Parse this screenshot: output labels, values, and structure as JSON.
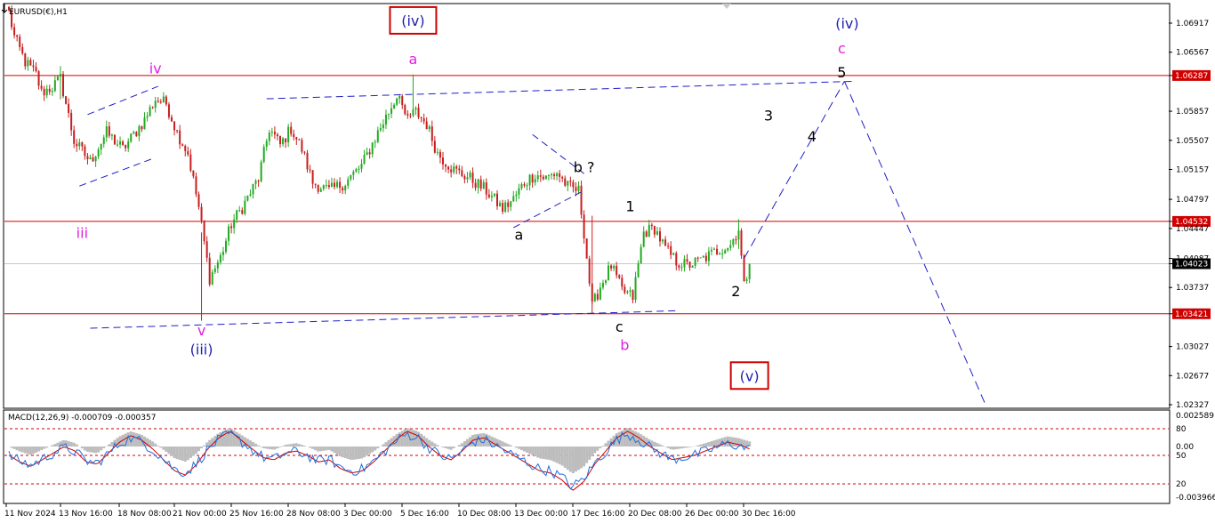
{
  "chart_data": {
    "type": "candlestick-wave-analysis",
    "symbol_label": "EURUSD(€),H1",
    "indicator_label": "MACD(12,26,9) -0.000709 -0.000357",
    "price_axis_ticks": [
      "1.06917",
      "1.06567",
      "1.06287",
      "1.05857",
      "1.05507",
      "1.05157",
      "1.04797",
      "1.04532",
      "1.04447",
      "1.04087",
      "1.04023",
      "1.03737",
      "1.03421",
      "1.03027",
      "1.02677",
      "1.02327"
    ],
    "price_range": [
      1.02327,
      1.07187
    ],
    "horizontal_levels": [
      {
        "value": 1.06287,
        "label": "1.06287",
        "color": "#d00000"
      },
      {
        "value": 1.04532,
        "label": "1.04532",
        "color": "#d00000"
      },
      {
        "value": 1.04023,
        "label": "1.04023",
        "color": "#000000"
      },
      {
        "value": 1.03421,
        "label": "1.03421",
        "color": "#d00000"
      }
    ],
    "time_axis_ticks": [
      "11 Nov 2024",
      "13 Nov 16:00",
      "18 Nov 08:00",
      "21 Nov 00:00",
      "25 Nov 16:00",
      "28 Nov 08:00",
      "3 Dec 00:00",
      "5 Dec 16:00",
      "10 Dec 08:00",
      "13 Dec 00:00",
      "17 Dec 16:00",
      "20 Dec 08:00",
      "26 Dec 00:00",
      "30 Dec 16:00"
    ],
    "price_path": [
      {
        "i": 0,
        "p": 1.0705
      },
      {
        "i": 2,
        "p": 1.0675
      },
      {
        "i": 6,
        "p": 1.0645
      },
      {
        "i": 10,
        "p": 1.063
      },
      {
        "i": 12,
        "p": 1.0608
      },
      {
        "i": 16,
        "p": 1.0615
      },
      {
        "i": 19,
        "p": 1.0625
      },
      {
        "i": 24,
        "p": 1.055
      },
      {
        "i": 30,
        "p": 1.0525
      },
      {
        "i": 36,
        "p": 1.056
      },
      {
        "i": 42,
        "p": 1.054
      },
      {
        "i": 50,
        "p": 1.0575
      },
      {
        "i": 54,
        "p": 1.06
      },
      {
        "i": 58,
        "p": 1.0595
      },
      {
        "i": 62,
        "p": 1.056
      },
      {
        "i": 66,
        "p": 1.0535
      },
      {
        "i": 70,
        "p": 1.047
      },
      {
        "i": 74,
        "p": 1.0385
      },
      {
        "i": 78,
        "p": 1.041
      },
      {
        "i": 82,
        "p": 1.045
      },
      {
        "i": 86,
        "p": 1.047
      },
      {
        "i": 92,
        "p": 1.0505
      },
      {
        "i": 96,
        "p": 1.0565
      },
      {
        "i": 100,
        "p": 1.0545
      },
      {
        "i": 104,
        "p": 1.0565
      },
      {
        "i": 108,
        "p": 1.054
      },
      {
        "i": 112,
        "p": 1.05
      },
      {
        "i": 118,
        "p": 1.049
      },
      {
        "i": 124,
        "p": 1.05
      },
      {
        "i": 130,
        "p": 1.052
      },
      {
        "i": 136,
        "p": 1.056
      },
      {
        "i": 140,
        "p": 1.0585
      },
      {
        "i": 144,
        "p": 1.061
      },
      {
        "i": 146,
        "p": 1.0575
      },
      {
        "i": 150,
        "p": 1.0585
      },
      {
        "i": 154,
        "p": 1.057
      },
      {
        "i": 158,
        "p": 1.0535
      },
      {
        "i": 164,
        "p": 1.0515
      },
      {
        "i": 170,
        "p": 1.0505
      },
      {
        "i": 176,
        "p": 1.049
      },
      {
        "i": 182,
        "p": 1.0468
      },
      {
        "i": 186,
        "p": 1.048
      },
      {
        "i": 190,
        "p": 1.05
      },
      {
        "i": 194,
        "p": 1.051
      },
      {
        "i": 198,
        "p": 1.0505
      },
      {
        "i": 202,
        "p": 1.0512
      },
      {
        "i": 206,
        "p": 1.0495
      },
      {
        "i": 210,
        "p": 1.049
      },
      {
        "i": 212,
        "p": 1.044
      },
      {
        "i": 215,
        "p": 1.035
      },
      {
        "i": 218,
        "p": 1.0375
      },
      {
        "i": 222,
        "p": 1.04
      },
      {
        "i": 226,
        "p": 1.037
      },
      {
        "i": 230,
        "p": 1.0362
      },
      {
        "i": 234,
        "p": 1.044
      },
      {
        "i": 238,
        "p": 1.0445
      },
      {
        "i": 242,
        "p": 1.042
      },
      {
        "i": 246,
        "p": 1.0405
      },
      {
        "i": 250,
        "p": 1.04
      },
      {
        "i": 254,
        "p": 1.0405
      },
      {
        "i": 258,
        "p": 1.0412
      },
      {
        "i": 262,
        "p": 1.042
      },
      {
        "i": 266,
        "p": 1.0425
      },
      {
        "i": 269,
        "p": 1.0445
      },
      {
        "i": 271,
        "p": 1.0375
      },
      {
        "i": 273,
        "p": 1.0402
      }
    ],
    "wave_labels": [
      {
        "text": "(iv)",
        "price": 1.0695,
        "bar": 149,
        "color": "#1f1fb0",
        "boxed": true
      },
      {
        "text": "a",
        "price": 1.06487,
        "bar": 149,
        "color": "#e020e0"
      },
      {
        "text": "iv",
        "price": 1.06377,
        "bar": 54,
        "color": "#e020e0"
      },
      {
        "text": "iii",
        "price": 1.04397,
        "bar": 27,
        "color": "#e020e0"
      },
      {
        "text": "v",
        "price": 1.03227,
        "bar": 71,
        "color": "#e020e0"
      },
      {
        "text": "(iii)",
        "price": 1.02997,
        "bar": 71,
        "color": "#1f1fb0"
      },
      {
        "text": "b ?",
        "price": 1.05187,
        "bar": 212,
        "color": "#000000"
      },
      {
        "text": "a",
        "price": 1.04377,
        "bar": 188,
        "color": "#000000"
      },
      {
        "text": "1",
        "price": 1.04717,
        "bar": 229,
        "color": "#000000"
      },
      {
        "text": "c",
        "price": 1.03267,
        "bar": 225,
        "color": "#000000"
      },
      {
        "text": "b",
        "price": 1.03047,
        "bar": 227,
        "color": "#e020e0"
      },
      {
        "text": "2",
        "price": 1.03697,
        "bar": 268,
        "color": "#000000"
      },
      {
        "text": "3",
        "price": 1.05807,
        "bar": 280,
        "color": "#000000"
      },
      {
        "text": "4",
        "price": 1.05557,
        "bar": 296,
        "color": "#000000"
      },
      {
        "text": "(iv)",
        "price": 1.06917,
        "bar": 309,
        "color": "#1f1fb0"
      },
      {
        "text": "c",
        "price": 1.06617,
        "bar": 307,
        "color": "#e020e0"
      },
      {
        "text": "5",
        "price": 1.06327,
        "bar": 307,
        "color": "#000000"
      },
      {
        "text": "(v)",
        "price": 1.02677,
        "bar": 273,
        "color": "#1f1fb0",
        "boxed": true
      }
    ],
    "projection_path": [
      {
        "bar": 271,
        "price": 1.04087
      },
      {
        "bar": 308,
        "price": 1.06217
      },
      {
        "bar": 360,
        "price": 1.02327
      }
    ],
    "trendlines": [
      {
        "from": {
          "bar": 95,
          "price": 1.06007
        },
        "to": {
          "bar": 311,
          "price": 1.06217
        }
      },
      {
        "from": {
          "bar": 30,
          "price": 1.03247
        },
        "to": {
          "bar": 246,
          "price": 1.03457
        }
      },
      {
        "from": {
          "bar": 29,
          "price": 1.05817
        },
        "to": {
          "bar": 55,
          "price": 1.06157
        }
      },
      {
        "from": {
          "bar": 26,
          "price": 1.04957
        },
        "to": {
          "bar": 53,
          "price": 1.05287
        }
      },
      {
        "from": {
          "bar": 193,
          "price": 1.05577
        },
        "to": {
          "bar": 212,
          "price": 1.05107
        }
      },
      {
        "from": {
          "bar": 186,
          "price": 1.04457
        },
        "to": {
          "bar": 211,
          "price": 1.04887
        }
      }
    ],
    "macd": {
      "levels": [
        "80",
        "50",
        "20"
      ],
      "value_ticks": [
        "0.002589",
        "0.00",
        "-0.003966"
      ],
      "series": [
        "main",
        "signal",
        "histogram"
      ],
      "path": [
        0,
        -15,
        -25,
        -10,
        5,
        20,
        10,
        -15,
        -20,
        5,
        30,
        45,
        35,
        15,
        -10,
        -35,
        -45,
        -20,
        15,
        40,
        55,
        35,
        15,
        -5,
        -10,
        5,
        10,
        0,
        -15,
        -10,
        -30,
        -40,
        -35,
        -15,
        10,
        35,
        55,
        45,
        20,
        0,
        -10,
        10,
        35,
        40,
        25,
        10,
        -5,
        -20,
        -35,
        -40,
        -55,
        -80,
        -60,
        -20,
        10,
        40,
        55,
        40,
        20,
        5,
        -10,
        -5,
        0,
        10,
        20,
        30,
        25,
        15
      ]
    }
  }
}
